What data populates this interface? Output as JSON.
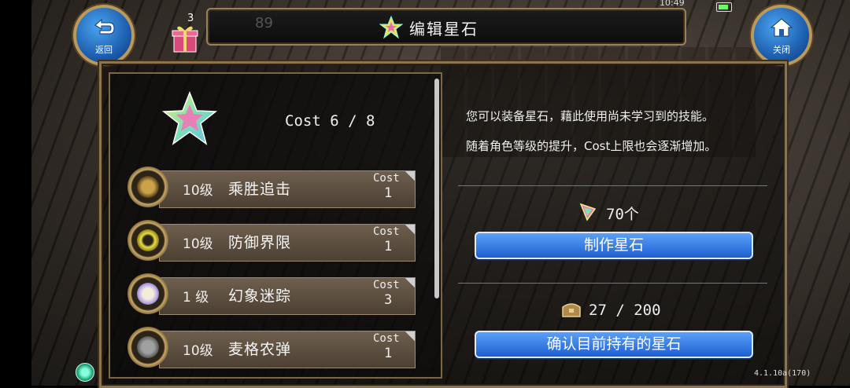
{
  "header": {
    "title": "编辑星石",
    "ghost_number": "89",
    "clock": "10:49"
  },
  "buttons": {
    "back_label": "返回",
    "close_label": "关闭"
  },
  "gift": {
    "count": "3"
  },
  "cost": {
    "label": "Cost",
    "value": "6 / 8"
  },
  "skills": [
    {
      "level": "10级",
      "name": "乘胜追击",
      "cost_label": "Cost",
      "cost": "1",
      "icon": "sword-plus-icon",
      "icon_color": "#c9a24a"
    },
    {
      "level": "10级",
      "name": "防御界限",
      "cost_label": "Cost",
      "cost": "1",
      "icon": "shield-ring-icon",
      "icon_color": "#e8e040"
    },
    {
      "level": "1 级",
      "name": "幻象迷踪",
      "cost_label": "Cost",
      "cost": "3",
      "icon": "phantom-icon",
      "icon_color": "#b9a7e8"
    },
    {
      "level": "10级",
      "name": "麦格农弹",
      "cost_label": "Cost",
      "cost": "1",
      "icon": "revolver-icon",
      "icon_color": "#a0a0a0"
    }
  ],
  "info": {
    "line1": "您可以装备星石，藉此使用尚未学习到的技能。",
    "line2": "随着角色等级的提升，Cost上限也会逐渐增加。"
  },
  "materials": {
    "count": "70个"
  },
  "craft_button": "制作星石",
  "capacity": {
    "value": "27 / 200"
  },
  "confirm_button": "确认目前持有的星石",
  "version": "4.1.10a(170)",
  "colors": {
    "accent_blue": "#1d5fd0",
    "frame_gold": "#8b7451"
  }
}
